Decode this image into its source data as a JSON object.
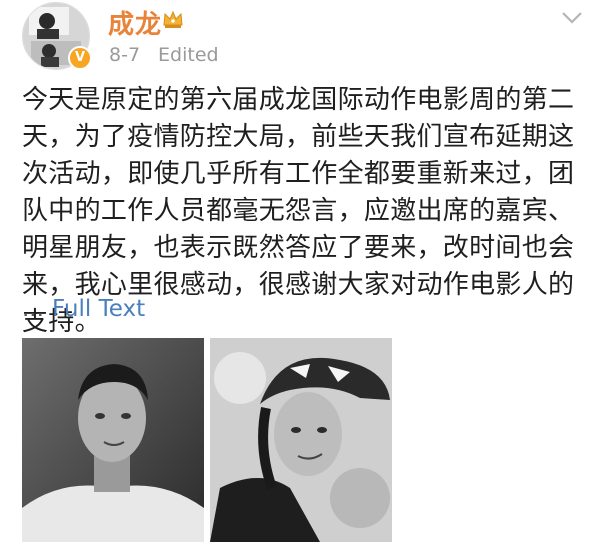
{
  "post": {
    "author": "成龙",
    "date": "8-7",
    "edited_label": "Edited",
    "text": "今天是原定的第六届成龙国际动作电影周的第二天，为了疫情防控大局，前些天我们宣布延期这次活动，即使几乎所有工作全都要重新来过，团队中的工作人员都毫无怨言，应邀出席的嘉宾、明星朋友，也表示既然答应了要来，改时间也会来，我心里很感动，很感谢大家对动作电影人的支持。",
    "ellipsis": "...",
    "full_text_label": "Full Text",
    "verified_badge": "V"
  },
  "icons": {
    "crown": "crown-icon",
    "menu": "chevron-down-icon"
  },
  "colors": {
    "author": "#e8833a",
    "link": "#4a7fbd",
    "meta": "#9a9a9a",
    "badge": "#f6a623"
  }
}
